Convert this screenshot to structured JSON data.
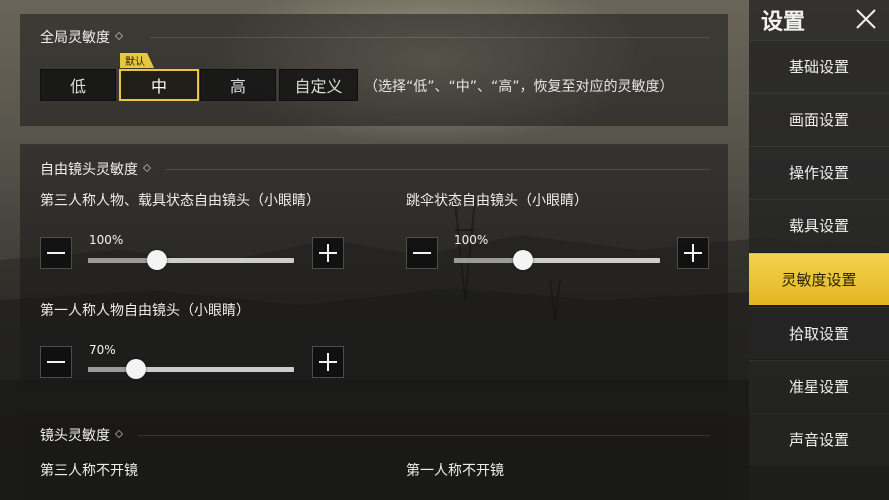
{
  "global_sensitivity": {
    "title": "全局灵敏度",
    "options": [
      "低",
      "中",
      "高",
      "自定义"
    ],
    "selected_index": 1,
    "default_badge": "默认",
    "hint": "（选择“低”、“中”、“高”，恢复至对应的灵敏度）"
  },
  "free_camera": {
    "title": "自由镜头灵敏度",
    "sliders": [
      {
        "label": "第三人称人物、载具状态自由镜头（小眼睛）",
        "value_text": "100%",
        "value": 100
      },
      {
        "label": "跳伞状态自由镜头（小眼睛）",
        "value_text": "100%",
        "value": 100
      },
      {
        "label": "第一人称人物自由镜头（小眼睛）",
        "value_text": "70%",
        "value": 70
      }
    ]
  },
  "camera_sensitivity": {
    "title": "镜头灵敏度",
    "items": [
      "第三人称不开镜",
      "第一人称不开镜"
    ]
  },
  "sidebar": {
    "title": "设置",
    "items": [
      {
        "label": "基础设置",
        "active": false
      },
      {
        "label": "画面设置",
        "active": false
      },
      {
        "label": "操作设置",
        "active": false
      },
      {
        "label": "载具设置",
        "active": false
      },
      {
        "label": "灵敏度设置",
        "active": true
      },
      {
        "label": "拾取设置",
        "active": false
      },
      {
        "label": "准星设置",
        "active": false
      },
      {
        "label": "声音设置",
        "active": false
      }
    ]
  },
  "colors": {
    "accent": "#e9c640",
    "panel_bg": "#191919",
    "text": "#e8e8e8"
  },
  "icons": {
    "close": "close-icon",
    "minus": "minus-icon",
    "plus": "plus-icon",
    "section_marker": "diamond-icon"
  }
}
